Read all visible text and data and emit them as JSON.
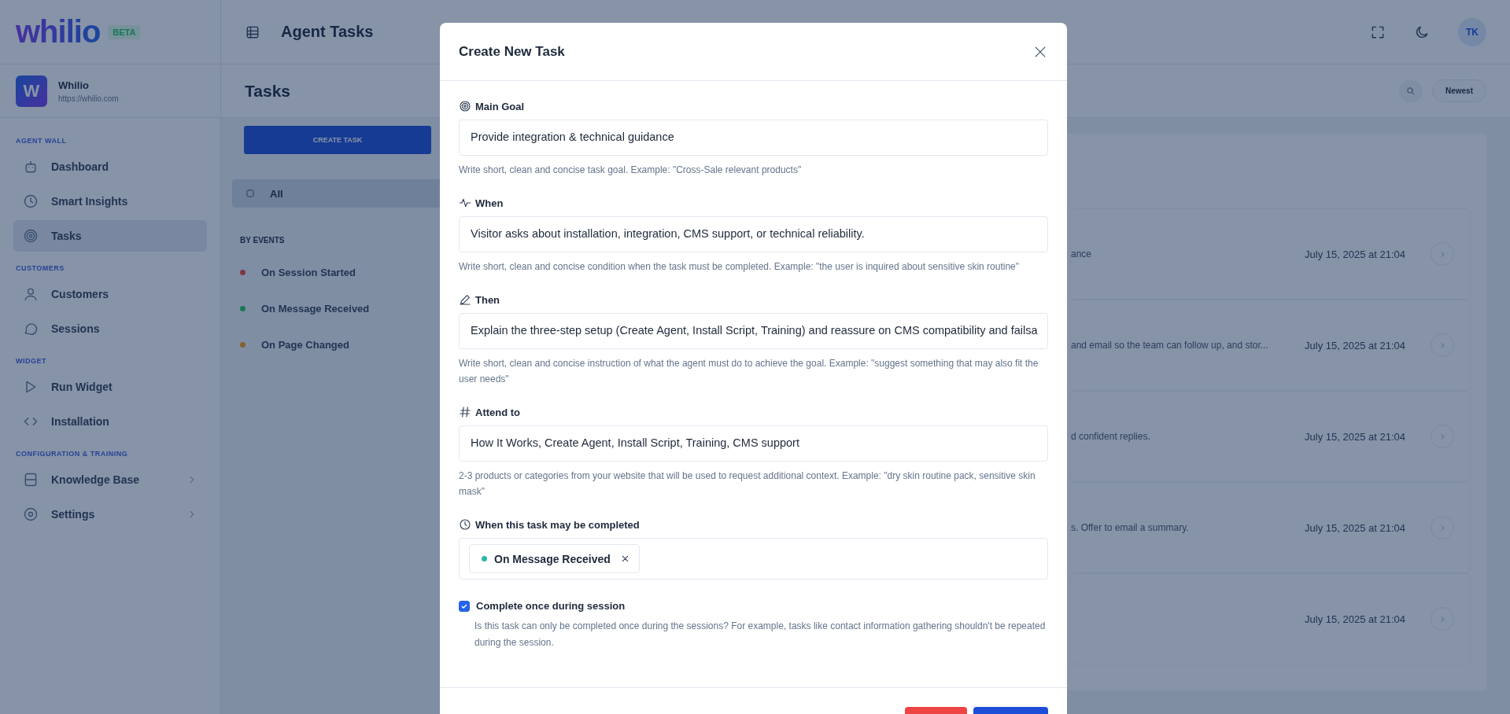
{
  "app": {
    "logo": "whilio",
    "badge": "BETA"
  },
  "workspace": {
    "initial": "W",
    "name": "Whilio",
    "url": "https://whilio.com"
  },
  "sidebar": {
    "sections": [
      {
        "title": "AGENT WALL",
        "items": [
          {
            "label": "Dashboard",
            "selected": false,
            "submenu": false
          },
          {
            "label": "Smart Insights",
            "selected": false,
            "submenu": false
          },
          {
            "label": "Tasks",
            "selected": true,
            "submenu": false
          }
        ]
      },
      {
        "title": "CUSTOMERS",
        "items": [
          {
            "label": "Customers",
            "selected": false,
            "submenu": false
          },
          {
            "label": "Sessions",
            "selected": false,
            "submenu": false
          }
        ]
      },
      {
        "title": "WIDGET",
        "items": [
          {
            "label": "Run Widget",
            "selected": false,
            "submenu": false
          },
          {
            "label": "Installation",
            "selected": false,
            "submenu": false
          }
        ]
      },
      {
        "title": "CONFIGURATION & TRAINING",
        "items": [
          {
            "label": "Knowledge Base",
            "selected": false,
            "submenu": true
          },
          {
            "label": "Settings",
            "selected": false,
            "submenu": true
          }
        ]
      }
    ]
  },
  "header": {
    "title": "Agent Tasks",
    "avatar": "TK"
  },
  "page": {
    "title": "Tasks",
    "sort": "Newest"
  },
  "filters": {
    "create_button": "CREATE TASK",
    "all": {
      "label": "All",
      "selected": true
    },
    "events_title": "BY EVENTS",
    "events": [
      {
        "label": "On Session Started",
        "color": "#7f364a"
      },
      {
        "label": "On Message Received",
        "color": "#197757"
      },
      {
        "label": "On Page Changed",
        "color": "#82632e"
      }
    ]
  },
  "task_rows": [
    {
      "text": "ance",
      "date": "July 15, 2025 at 21:04"
    },
    {
      "text": "and email so the team can follow up, and stor...",
      "date": "July 15, 2025 at 21:04"
    },
    {
      "text": "d confident replies.",
      "date": "July 15, 2025 at 21:04"
    },
    {
      "text": "s. Offer to email a summary.",
      "date": "July 15, 2025 at 21:04"
    },
    {
      "date": "July 15, 2025 at 21:04"
    }
  ],
  "modal": {
    "title": "Create New Task",
    "fields": [
      {
        "kind": "text",
        "label": "Main Goal",
        "value": "Provide integration & technical guidance",
        "help": "Write short, clean and concise task goal. Example: \"Cross-Sale relevant products\""
      },
      {
        "kind": "text",
        "label": "When",
        "value": "Visitor asks about installation, integration, CMS support, or technical reliability.",
        "help": "Write short, clean and concise condition when the task must be completed. Example: \"the user is inquired about sensitive skin routine\""
      },
      {
        "kind": "text",
        "label": "Then",
        "value": "Explain the three-step setup (Create Agent, Install Script, Training) and reassure on CMS compatibility and failsa",
        "help": "Write short, clean and concise instruction of what the agent must do to achieve the goal. Example: \"suggest something that may also fit the user needs\""
      },
      {
        "kind": "text",
        "label": "Attend to",
        "value": "How It Works, Create Agent, Install Script, Training, CMS support",
        "help": "2-3 products or categories from your website that will be used to request additional context. Example: \"dry skin routine pack, sensitive skin mask\""
      },
      {
        "kind": "tags",
        "label": "When this task may be completed",
        "tags": [
          {
            "label": "On Message Received",
            "color": "#2ab7a9"
          }
        ]
      }
    ],
    "checkbox": {
      "label": "Complete once during session",
      "checked": true,
      "help": "Is this task can only be completed once during the sessions? For example, tasks like contact information gathering shouldn't be repeated during the session."
    },
    "footer_buttons": [
      {
        "kind": "danger"
      },
      {
        "kind": "primary"
      }
    ]
  }
}
